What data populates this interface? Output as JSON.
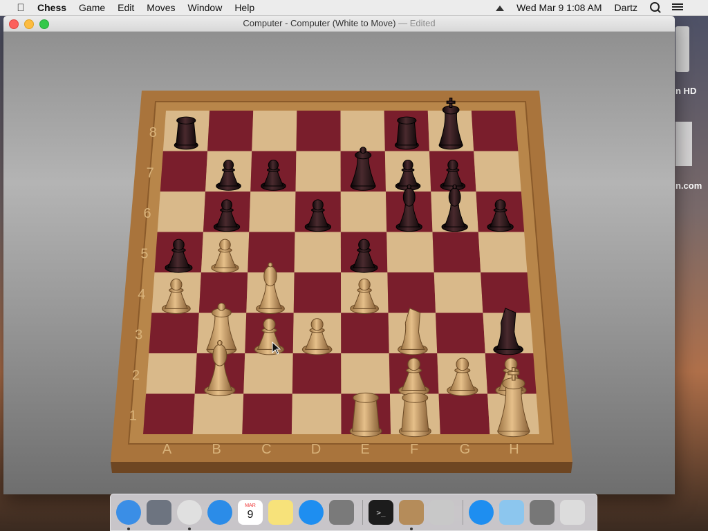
{
  "menubar": {
    "app_name": "Chess",
    "items": [
      "Game",
      "Edit",
      "Moves",
      "Window",
      "Help"
    ],
    "datetime": "Wed Mar 9  1:08 AM",
    "user": "Dartz"
  },
  "window": {
    "title": "Computer - Computer   (White to Move)",
    "edited_suffix": " — Edited"
  },
  "desktop": {
    "label_hd": "n HD",
    "label_com": "n.com"
  },
  "board": {
    "ranks": [
      "8",
      "7",
      "6",
      "5",
      "4",
      "3",
      "2",
      "1"
    ],
    "files": [
      "A",
      "B",
      "C",
      "D",
      "E",
      "F",
      "G",
      "H"
    ],
    "light_color": "#d9b98a",
    "dark_color": "#7a1e2c",
    "frame_color": "#a9743c",
    "white_piece_color": "#d2a56a",
    "black_piece_color": "#241416",
    "pieces": [
      {
        "square": "a8",
        "type": "rook",
        "color": "black"
      },
      {
        "square": "f8",
        "type": "rook",
        "color": "black"
      },
      {
        "square": "g8",
        "type": "king",
        "color": "black"
      },
      {
        "square": "e7",
        "type": "queen",
        "color": "black"
      },
      {
        "square": "b7",
        "type": "pawn",
        "color": "black"
      },
      {
        "square": "c7",
        "type": "pawn",
        "color": "black"
      },
      {
        "square": "f7",
        "type": "pawn",
        "color": "black"
      },
      {
        "square": "g7",
        "type": "pawn",
        "color": "black"
      },
      {
        "square": "b6",
        "type": "pawn",
        "color": "black"
      },
      {
        "square": "d6",
        "type": "pawn",
        "color": "black"
      },
      {
        "square": "f6",
        "type": "bishop",
        "color": "black"
      },
      {
        "square": "g6",
        "type": "bishop",
        "color": "black"
      },
      {
        "square": "h6",
        "type": "pawn",
        "color": "black"
      },
      {
        "square": "a5",
        "type": "pawn",
        "color": "black"
      },
      {
        "square": "e5",
        "type": "pawn",
        "color": "black"
      },
      {
        "square": "h3",
        "type": "knight",
        "color": "black"
      },
      {
        "square": "b5",
        "type": "pawn",
        "color": "white"
      },
      {
        "square": "a4",
        "type": "pawn",
        "color": "white"
      },
      {
        "square": "c4",
        "type": "bishop",
        "color": "white"
      },
      {
        "square": "e4",
        "type": "pawn",
        "color": "white"
      },
      {
        "square": "b3",
        "type": "queen",
        "color": "white"
      },
      {
        "square": "c3",
        "type": "pawn",
        "color": "white"
      },
      {
        "square": "d3",
        "type": "pawn",
        "color": "white"
      },
      {
        "square": "f3",
        "type": "knight",
        "color": "white"
      },
      {
        "square": "b2",
        "type": "bishop",
        "color": "white"
      },
      {
        "square": "f2",
        "type": "pawn",
        "color": "white"
      },
      {
        "square": "g2",
        "type": "pawn",
        "color": "white"
      },
      {
        "square": "h2",
        "type": "pawn",
        "color": "white"
      },
      {
        "square": "e1",
        "type": "rook",
        "color": "white"
      },
      {
        "square": "f1",
        "type": "rook",
        "color": "white"
      },
      {
        "square": "h1",
        "type": "king",
        "color": "white"
      }
    ]
  },
  "dock": {
    "items": [
      {
        "name": "finder-icon",
        "color": "#3a8ee6",
        "running": true
      },
      {
        "name": "launchpad-icon",
        "color": "#6d7480",
        "running": false
      },
      {
        "name": "chrome-icon",
        "color": "#e0e0e0",
        "running": true
      },
      {
        "name": "safari-icon",
        "color": "#2b8ce8",
        "running": false
      },
      {
        "name": "calendar-icon",
        "color": "#ffffff",
        "running": false
      },
      {
        "name": "notes-icon",
        "color": "#f7e27a",
        "running": false
      },
      {
        "name": "app-store-icon",
        "color": "#1e8ef0",
        "running": false
      },
      {
        "name": "system-preferences-icon",
        "color": "#7a7a7a",
        "running": false
      },
      {
        "name": "terminal-icon",
        "color": "#1c1c1c",
        "running": false
      },
      {
        "name": "chess-icon",
        "color": "#b58c5a",
        "running": true
      },
      {
        "name": "automator-icon",
        "color": "#c8c8c8",
        "running": false
      },
      {
        "name": "app-store-folder-icon",
        "color": "#1e8ef0",
        "running": false
      },
      {
        "name": "downloads-folder-icon",
        "color": "#8cc6ee",
        "running": false
      },
      {
        "name": "photos-stack-icon",
        "color": "#777777",
        "running": false
      },
      {
        "name": "trash-icon",
        "color": "#dcdcdc",
        "running": false
      }
    ],
    "calendar_month": "MAR",
    "calendar_day": "9"
  }
}
